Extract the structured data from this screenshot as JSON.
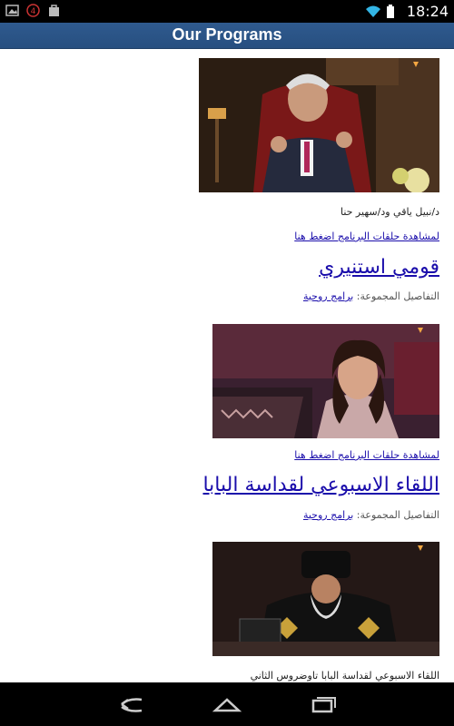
{
  "status": {
    "time": "18:24",
    "left_icons": [
      "image-icon",
      "badge-4-icon",
      "bag-icon"
    ],
    "right_icons": [
      "wifi-icon",
      "battery-icon"
    ]
  },
  "appbar": {
    "title": "Our Programs"
  },
  "programs": [
    {
      "caption": "د/نبيل ياقي ود/سهير حنا",
      "watch": "لمشاهدة حلقات البرنامج اضغط هنا",
      "title": "قومي استنيري",
      "cat_label": "التفاصيل المجموعة:",
      "cat_link": "برامج روحية"
    },
    {
      "watch": "لمشاهدة حلقات البرنامج اضغط هنا",
      "title": "اللقاء الاسبوعي لقداسة البابا",
      "cat_label": "التفاصيل المجموعة:",
      "cat_link": "برامج روحية"
    },
    {
      "caption": "اللقاء الاسبوعي لقداسة البابا تاوضروس الثاني"
    }
  ],
  "nav": {
    "icons": [
      "back-icon",
      "home-icon",
      "recents-icon"
    ]
  },
  "colors": {
    "appbar": "#2b5486",
    "link": "#1a0dab"
  }
}
